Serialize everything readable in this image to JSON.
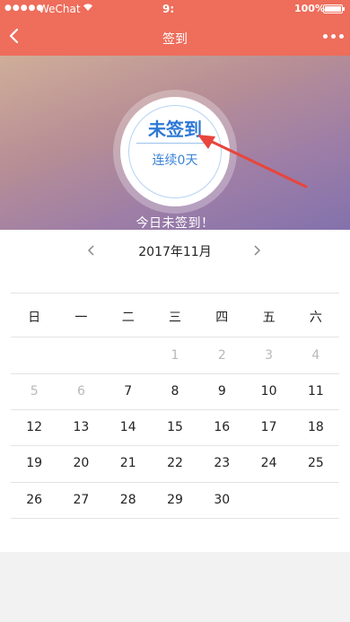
{
  "status_bar": {
    "carrier": "WeChat",
    "time": "9:",
    "battery": "100%"
  },
  "header": {
    "title": "签到",
    "back_icon": "chevron-left-icon",
    "more_icon": "more-dots-icon"
  },
  "hero": {
    "sign_status": "未签到",
    "streak": "连续0天",
    "today_message": "今日未签到！"
  },
  "calendar": {
    "month_label": "2017年11月",
    "prev_icon": "chevron-left-icon",
    "next_icon": "chevron-right-icon",
    "weekdays": [
      "日",
      "一",
      "二",
      "三",
      "四",
      "五",
      "六"
    ],
    "weeks": [
      [
        {
          "d": "",
          "m": false
        },
        {
          "d": "",
          "m": false
        },
        {
          "d": "",
          "m": false
        },
        {
          "d": "1",
          "m": true
        },
        {
          "d": "2",
          "m": true
        },
        {
          "d": "3",
          "m": true
        },
        {
          "d": "4",
          "m": true
        }
      ],
      [
        {
          "d": "5",
          "m": true
        },
        {
          "d": "6",
          "m": true
        },
        {
          "d": "7",
          "m": false
        },
        {
          "d": "8",
          "m": false
        },
        {
          "d": "9",
          "m": false
        },
        {
          "d": "10",
          "m": false
        },
        {
          "d": "11",
          "m": false
        }
      ],
      [
        {
          "d": "12",
          "m": false
        },
        {
          "d": "13",
          "m": false
        },
        {
          "d": "14",
          "m": false
        },
        {
          "d": "15",
          "m": false
        },
        {
          "d": "16",
          "m": false
        },
        {
          "d": "17",
          "m": false
        },
        {
          "d": "18",
          "m": false
        }
      ],
      [
        {
          "d": "19",
          "m": false
        },
        {
          "d": "20",
          "m": false
        },
        {
          "d": "21",
          "m": false
        },
        {
          "d": "22",
          "m": false
        },
        {
          "d": "23",
          "m": false
        },
        {
          "d": "24",
          "m": false
        },
        {
          "d": "25",
          "m": false
        }
      ],
      [
        {
          "d": "26",
          "m": false
        },
        {
          "d": "27",
          "m": false
        },
        {
          "d": "28",
          "m": false
        },
        {
          "d": "29",
          "m": false
        },
        {
          "d": "30",
          "m": false
        },
        {
          "d": "",
          "m": false
        },
        {
          "d": "",
          "m": false
        }
      ]
    ]
  },
  "colors": {
    "header": "#ee6d5b",
    "accent_blue": "#2d78d6",
    "arrow_red": "#e8453c"
  }
}
